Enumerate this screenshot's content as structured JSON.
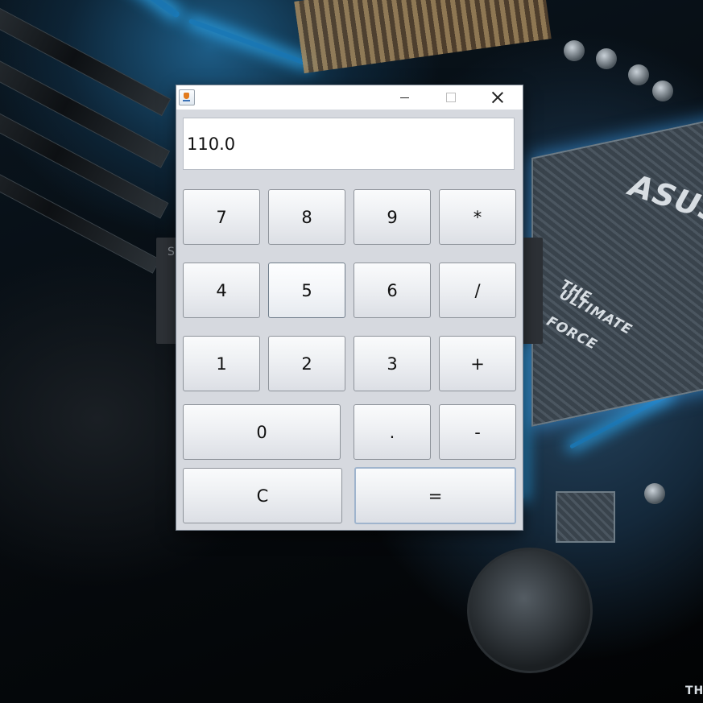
{
  "wallpaper": {
    "brand_text": "ASUS",
    "slogan_line1": "THE",
    "slogan_line2": "ULTIMATE",
    "slogan_line3": "FORCE",
    "corner_text": "TH",
    "background_window_initial": "S"
  },
  "window": {
    "minimize_label": "—",
    "maximize_label": "□",
    "close_label": "✕"
  },
  "display": {
    "value": "110.0"
  },
  "keys": {
    "seven": "7",
    "eight": "8",
    "nine": "9",
    "multiply": "*",
    "four": "4",
    "five": "5",
    "six": "6",
    "divide": "/",
    "one": "1",
    "two": "2",
    "three": "3",
    "plus": "+",
    "zero": "0",
    "decimal": ".",
    "minus": "-",
    "clear": "C",
    "equals": "="
  },
  "colors": {
    "window_background": "#d6d9df",
    "titlebar": "#ffffff",
    "accent_glow": "#2fb4ff"
  }
}
